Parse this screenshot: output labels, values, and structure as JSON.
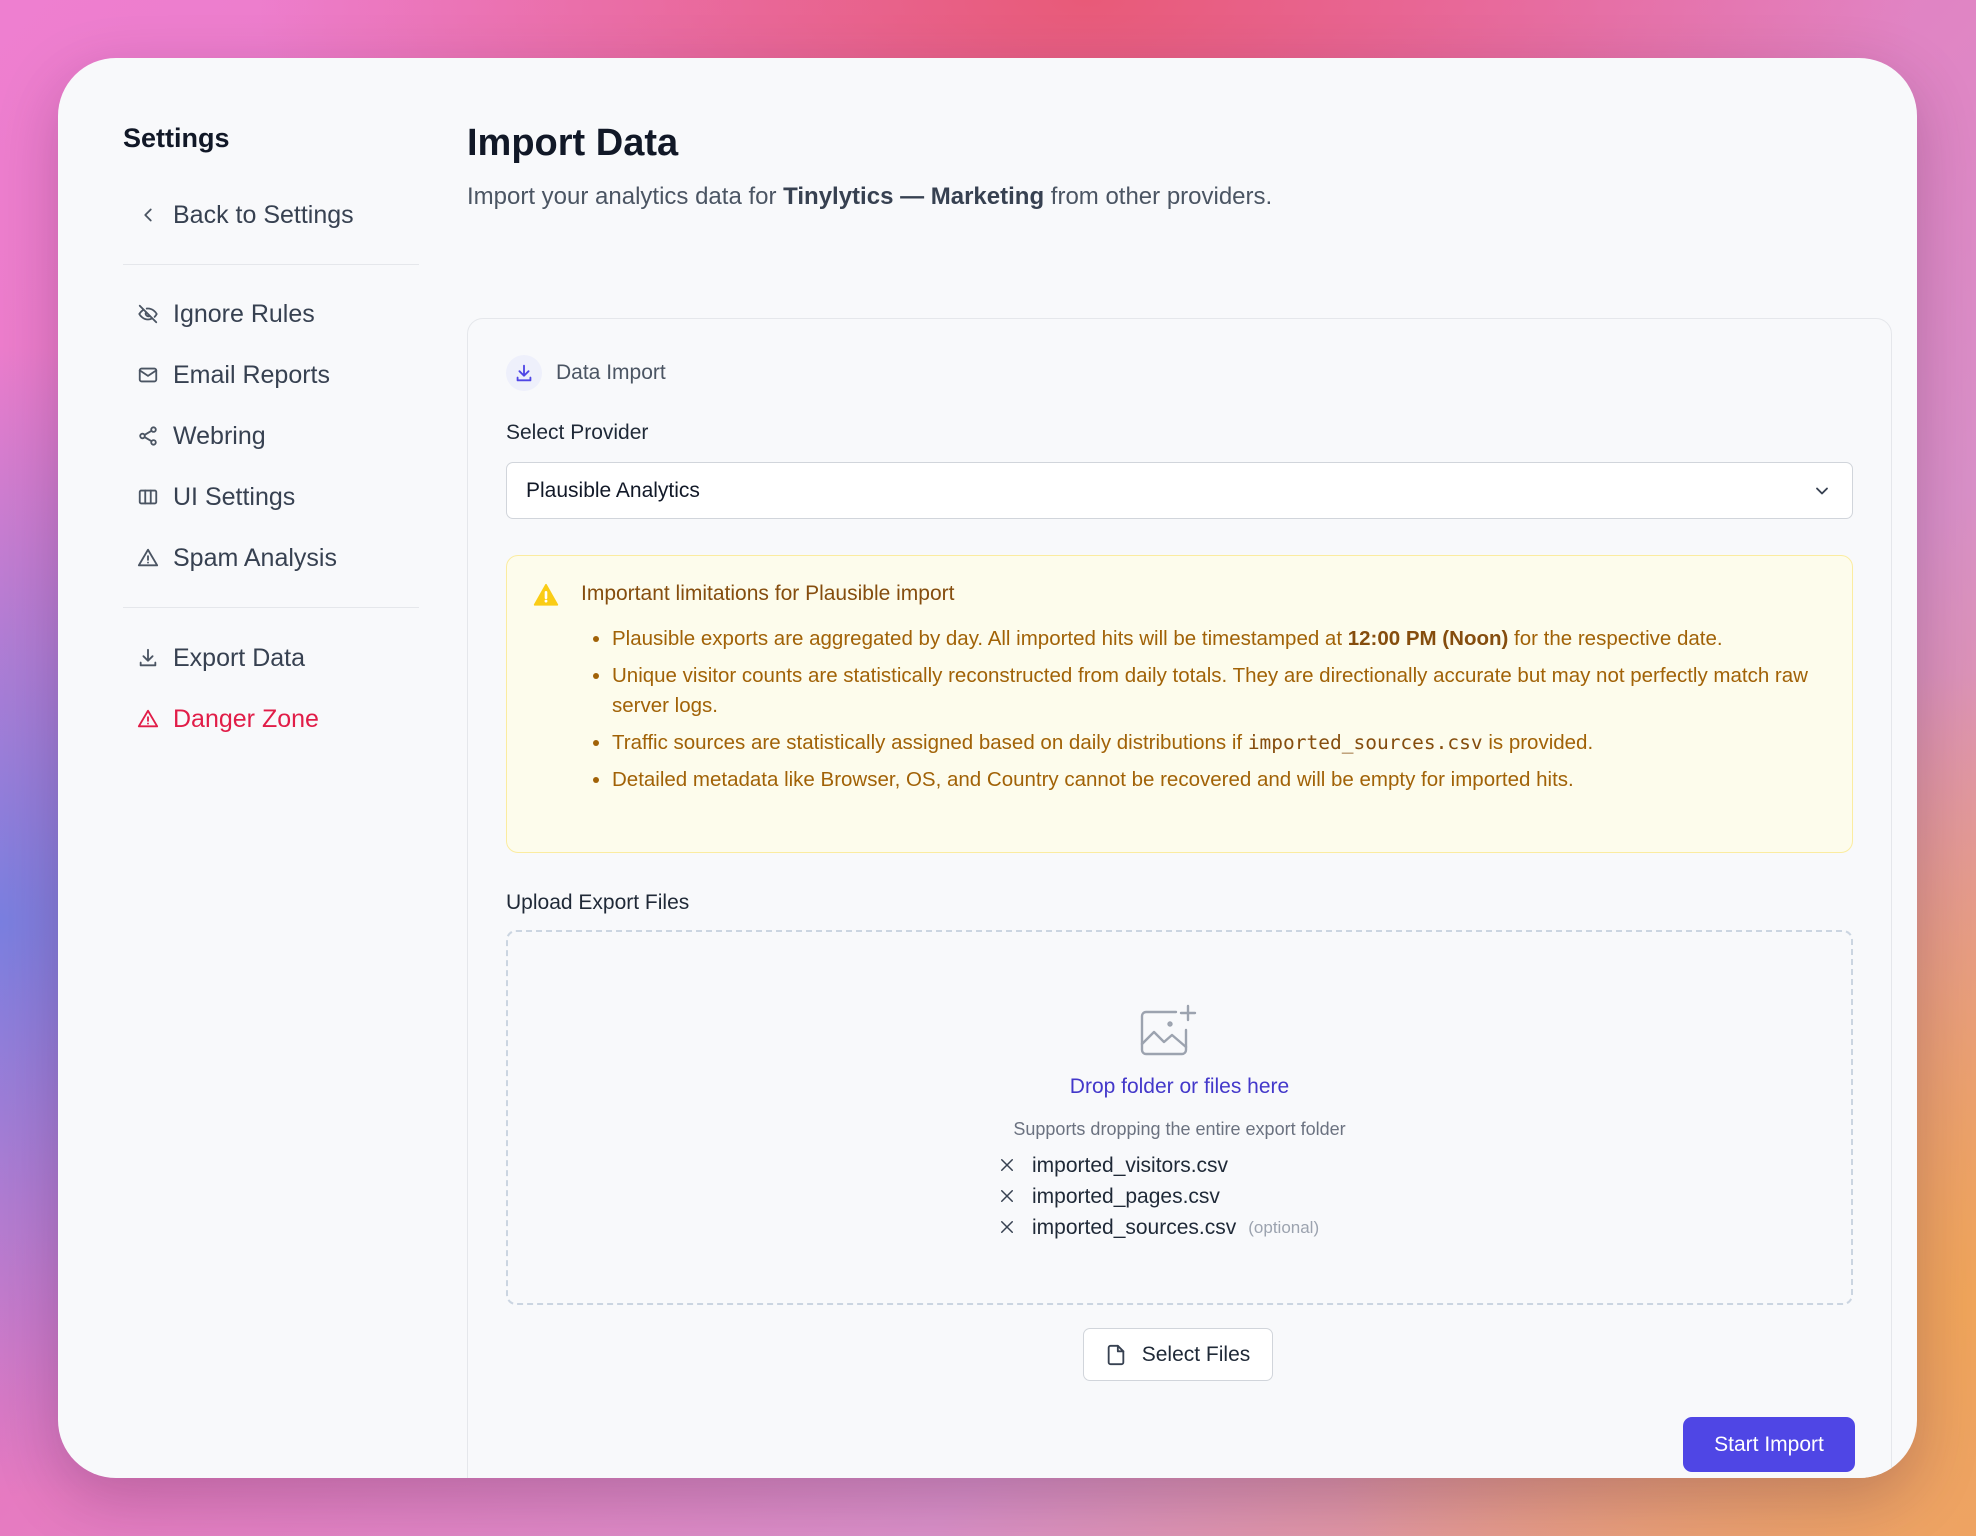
{
  "sidebar": {
    "title": "Settings",
    "back_label": "Back to Settings",
    "items": [
      {
        "label": "Ignore Rules",
        "icon": "eye-off-icon"
      },
      {
        "label": "Email Reports",
        "icon": "mail-icon"
      },
      {
        "label": "Webring",
        "icon": "share-icon"
      },
      {
        "label": "UI Settings",
        "icon": "columns-icon"
      },
      {
        "label": "Spam Analysis",
        "icon": "warning-icon"
      }
    ],
    "export_label": "Export Data",
    "danger_label": "Danger Zone"
  },
  "header": {
    "title": "Import Data",
    "subtitle_prefix": "Import your analytics data for ",
    "subtitle_site": "Tinylytics — Marketing",
    "subtitle_suffix": " from other providers."
  },
  "card": {
    "title": "Data Import",
    "provider_label": "Select Provider",
    "provider_value": "Plausible Analytics",
    "warning": {
      "title": "Important limitations for Plausible import",
      "item1_prefix": "Plausible exports are aggregated by day. All imported hits will be timestamped at ",
      "item1_bold": "12:00 PM (Noon)",
      "item1_suffix": " for the respective date.",
      "item2": "Unique visitor counts are statistically reconstructed from daily totals. They are directionally accurate but may not perfectly match raw server logs.",
      "item3_prefix": "Traffic sources are statistically assigned based on daily distributions if ",
      "item3_code": "imported_sources.csv",
      "item3_suffix": " is provided.",
      "item4": "Detailed metadata like Browser, OS, and Country cannot be recovered and will be empty for imported hits."
    },
    "upload_label": "Upload Export Files",
    "drop_title": "Drop folder or files here",
    "drop_sub": "Supports dropping the entire export folder",
    "files": [
      {
        "name": "imported_visitors.csv",
        "note": ""
      },
      {
        "name": "imported_pages.csv",
        "note": ""
      },
      {
        "name": "imported_sources.csv",
        "note": "(optional)"
      }
    ],
    "select_files_label": "Select Files",
    "start_label": "Start Import"
  },
  "colors": {
    "accent": "#4f46e5",
    "danger": "#e11d48",
    "warning_text": "#a16207",
    "warning_bg": "#fdfcec"
  }
}
